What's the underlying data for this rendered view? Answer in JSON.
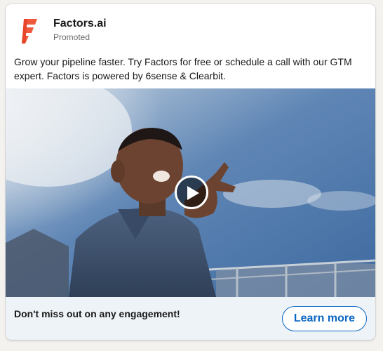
{
  "post": {
    "company_name": "Factors.ai",
    "promoted_label": "Promoted",
    "body": "Grow your pipeline faster. Try Factors for free or schedule a call with our GTM expert. Factors is powered by 6sense & Clearbit.",
    "logo_icon": "factors-logo-icon",
    "brand_color": "#f05a3c"
  },
  "media": {
    "type": "video",
    "play_icon": "play-icon"
  },
  "footer": {
    "headline": "Don't miss out on any engagement!",
    "cta_label": "Learn more",
    "cta_color": "#0a66c2"
  }
}
